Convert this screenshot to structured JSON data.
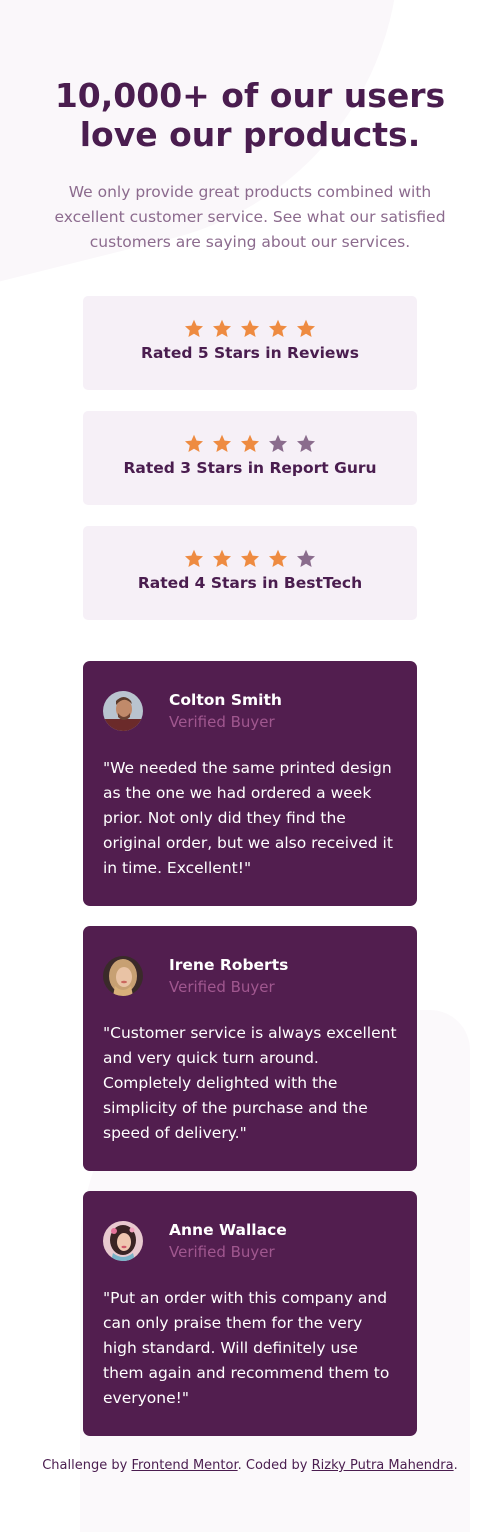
{
  "hero": {
    "title_line1": "10,000+ of our users",
    "title_line2": "love our products.",
    "subtitle": "We only provide great products combined with excellent customer service. See what our satisfied customers are saying about our services."
  },
  "ratings": [
    {
      "label": "Rated 5 Stars in Reviews",
      "stars": 5
    },
    {
      "label": "Rated 3 Stars in Report Guru",
      "stars": 3
    },
    {
      "label": "Rated 4 Stars in BestTech",
      "stars": 4
    }
  ],
  "testimonials": [
    {
      "name": "Colton Smith",
      "role": "Verified Buyer",
      "quote": "\"We needed the same printed design as the one we had ordered a week prior. Not only did they find the original order, but we also received it in time. Excellent!\""
    },
    {
      "name": "Irene Roberts",
      "role": "Verified Buyer",
      "quote": "\"Customer service is always excellent and very quick turn around. Completely delighted with the simplicity of the purchase and the speed of delivery.\""
    },
    {
      "name": "Anne Wallace",
      "role": "Verified Buyer",
      "quote": "\"Put an order with this company and can only praise them for the very high standard. Will definitely use them again and recommend them to everyone!\""
    }
  ],
  "footer": {
    "prefix": "Challenge by ",
    "link1": "Frontend Mentor",
    "middle": ". Coded by ",
    "link2": "Rizky Putra Mahendra",
    "suffix": "."
  },
  "colors": {
    "accent": "#4a1d4f",
    "star_filled": "#ee8b41",
    "star_empty": "#8a6c8d",
    "card_bg": "#521e4f",
    "rating_bg": "#f6f0f7",
    "verified": "#a0578f"
  },
  "icons": {
    "star": "star-icon",
    "avatar": "avatar-photo"
  }
}
